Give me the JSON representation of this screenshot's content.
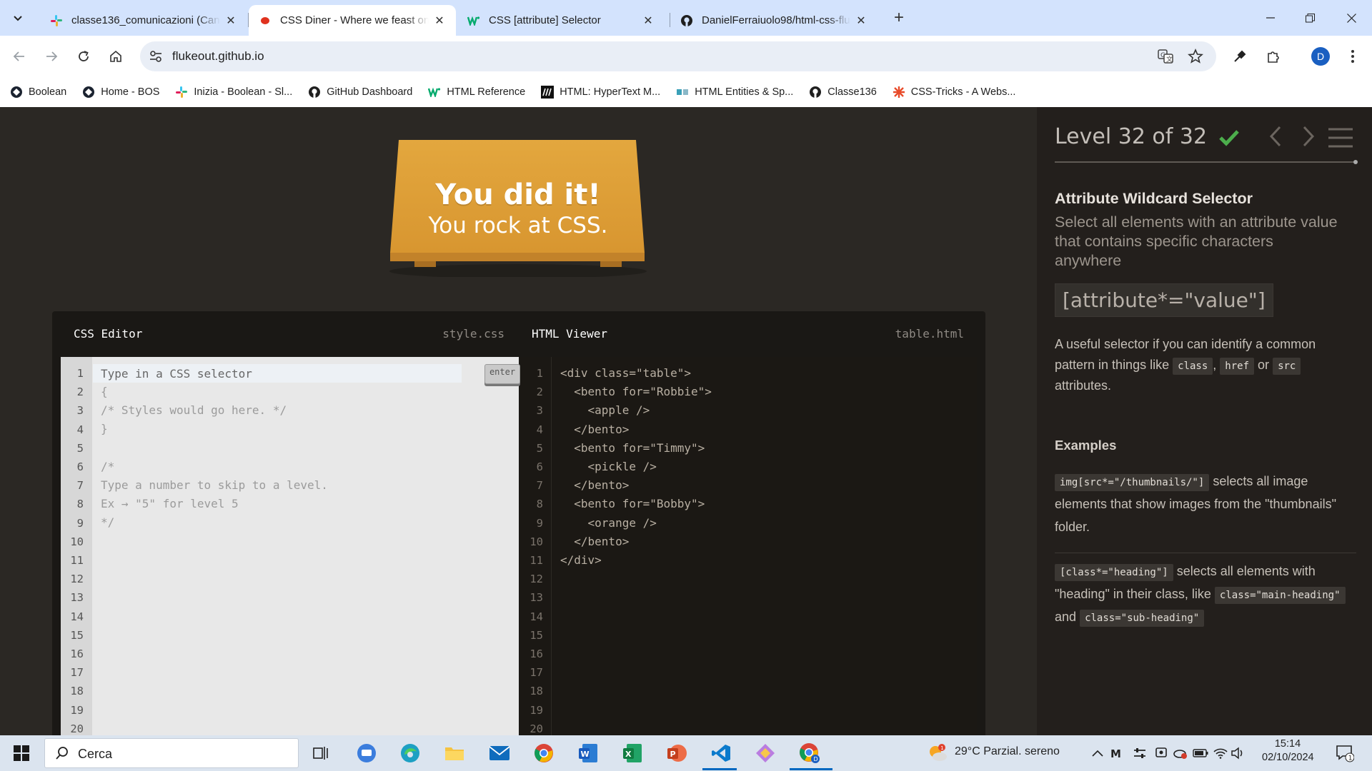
{
  "browser": {
    "tabs": [
      {
        "title": "classe136_comunicazioni (Cana",
        "icon": "slack-icon",
        "active": false
      },
      {
        "title": "CSS Diner - Where we feast on",
        "icon": "css-diner-icon",
        "active": true
      },
      {
        "title": "CSS [attribute] Selector",
        "icon": "w3schools-icon",
        "active": false
      },
      {
        "title": "DanielFerraiuolo98/html-css-flu",
        "icon": "github-icon",
        "active": false
      }
    ],
    "url": "flukeout.github.io",
    "profile_initial": "D",
    "bookmarks": [
      {
        "label": "Boolean",
        "icon": "boolean-icon"
      },
      {
        "label": "Home - BOS",
        "icon": "boolean-icon"
      },
      {
        "label": "Inizia - Boolean - Sl...",
        "icon": "slack-icon"
      },
      {
        "label": "GitHub Dashboard",
        "icon": "github-icon"
      },
      {
        "label": "HTML Reference",
        "icon": "w3schools-icon"
      },
      {
        "label": "HTML: HyperText M...",
        "icon": "mdn-icon"
      },
      {
        "label": "HTML Entities & Sp...",
        "icon": "entities-icon"
      },
      {
        "label": "Classe136",
        "icon": "github-icon"
      },
      {
        "label": "CSS-Tricks - A Webs...",
        "icon": "css-tricks-icon"
      }
    ]
  },
  "game": {
    "win_title": "You did it!",
    "win_subtitle": "You rock at CSS.",
    "css_editor": {
      "title": "CSS Editor",
      "file": "style.css",
      "input_placeholder": "Type in a CSS selector",
      "enter_label": "enter",
      "lines": [
        "{",
        "/* Styles would go here. */",
        "}",
        "",
        "/*",
        "Type a number to skip to a level.",
        "Ex → \"5\" for level 5",
        "*/"
      ],
      "line_numbers": [
        "1",
        "2",
        "3",
        "4",
        "5",
        "6",
        "7",
        "8",
        "9",
        "10",
        "11",
        "12",
        "13",
        "14",
        "15",
        "16",
        "17",
        "18",
        "19",
        "20"
      ]
    },
    "html_viewer": {
      "title": "HTML Viewer",
      "file": "table.html",
      "lines": [
        "<div class=\"table\">",
        "  <bento for=\"Robbie\">",
        "    <apple />",
        "  </bento>",
        "  <bento for=\"Timmy\">",
        "    <pickle />",
        "  </bento>",
        "  <bento for=\"Bobby\">",
        "    <orange />",
        "  </bento>",
        "</div>"
      ],
      "line_numbers": [
        "1",
        "2",
        "3",
        "4",
        "5",
        "6",
        "7",
        "8",
        "9",
        "10",
        "11",
        "12",
        "13",
        "14",
        "15",
        "16",
        "17",
        "18",
        "19",
        "20"
      ]
    }
  },
  "sidebar": {
    "level_text": "Level 32 of 32",
    "completed": true,
    "selector_name": "Attribute Wildcard Selector",
    "description": "Select all elements with an attribute value that contains specific characters anywhere",
    "syntax": "[attribute*=\"value\"]",
    "hint_pre": "A useful selector if you can identify a common pattern in things like",
    "hint_tag1": "class",
    "hint_sep": ",",
    "hint_tag2": "href",
    "hint_or": "or",
    "hint_tag3": "src",
    "hint_post": "attributes.",
    "examples_heading": "Examples",
    "example1_code": "img[src*=\"/thumbnails/\"]",
    "example1_text": "selects all image elements that show images from the \"thumbnails\" folder.",
    "example2_code": "[class*=\"heading\"]",
    "example2_text_a": "selects all elements with \"heading\" in their class, like",
    "example2_code_b": "class=\"main-heading\"",
    "example2_and": "and",
    "example2_code_c": "class=\"sub-heading\""
  },
  "taskbar": {
    "search_placeholder": "Cerca",
    "weather_temp": "29°C",
    "weather_text": "Parzial. sereno",
    "weather_badge": "1",
    "time": "15:14",
    "date": "02/10/2024",
    "notification_count": "1"
  },
  "colors": {
    "page_bg": "#2b2824",
    "sidebar_bg": "#231f1c",
    "table_orange": "#e0a23a",
    "check_green": "#4cae4c",
    "chrome_tabbar": "#d3e3fd"
  }
}
